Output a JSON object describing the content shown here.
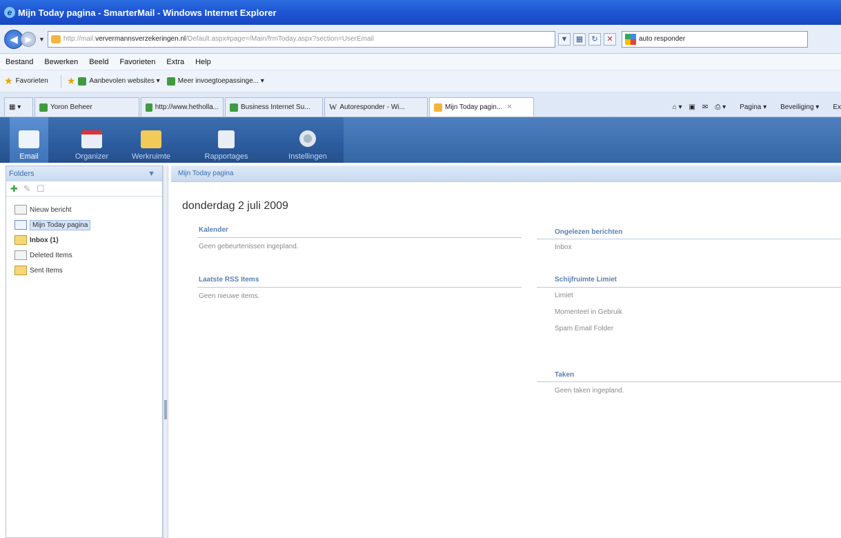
{
  "window": {
    "title": "Mijn Today pagina - SmarterMail - Windows Internet Explorer"
  },
  "address": {
    "url_prefix": "http://mail.",
    "url_host": "ververmannsverzekeringen.nl",
    "url_rest": "/Default.aspx#page=/Main/frmToday.aspx?section=UserEmail",
    "search_value": "auto responder"
  },
  "menubar": {
    "items": [
      "Bestand",
      "Bewerken",
      "Beeld",
      "Favorieten",
      "Extra",
      "Help"
    ]
  },
  "favorites": {
    "label": "Favorieten",
    "items": [
      "Aanbevolen websites",
      "Meer invoegtoepassinge..."
    ]
  },
  "tabs": {
    "items": [
      "Yoron Beheer",
      "http://www.hetholla...",
      "Business Internet Su...",
      "Autoresponder - Wi...",
      "Mijn Today pagin..."
    ],
    "commands": [
      "Pagina",
      "Beveiliging",
      "Ex"
    ]
  },
  "appnav": {
    "items": [
      "Email",
      "Organizer",
      "Werkruimte",
      "Rapportages",
      "Instellingen"
    ]
  },
  "folders": {
    "header": "Folders",
    "nodes": [
      "Nieuw bericht",
      "Mijn Today pagina",
      "Inbox (1)",
      "Deleted Items",
      "Sent Items"
    ]
  },
  "main": {
    "header": "Mijn Today pagina",
    "date": "donderdag 2 juli 2009",
    "sections": {
      "kalender": {
        "title": "Kalender",
        "rows": [
          "Geen gebeurtenissen ingepland."
        ]
      },
      "rss": {
        "title": "Laatste RSS Items",
        "rows": [
          "Geen nieuwe items."
        ]
      },
      "ongelezen": {
        "title": "Ongelezen berichten",
        "rows": [
          "Inbox"
        ]
      },
      "schijf": {
        "title": "Schijfruimte Limiet",
        "rows": [
          "Limiet",
          "Momenteel in Gebruik",
          "Spam Email Folder"
        ]
      },
      "taken": {
        "title": "Taken",
        "rows": [
          "Geen taken ingepland."
        ]
      }
    }
  }
}
